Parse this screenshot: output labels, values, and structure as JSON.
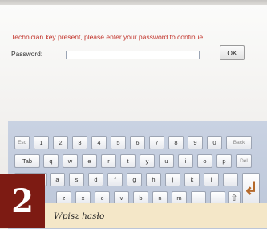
{
  "dialog": {
    "message": "Technician key present, please enter your password to continue",
    "password_label": "Password:",
    "password_value": "",
    "ok_label": "OK"
  },
  "keyboard": {
    "row1": [
      "Esc",
      "1",
      "2",
      "3",
      "4",
      "5",
      "6",
      "7",
      "8",
      "9",
      "0",
      "Back"
    ],
    "row2": [
      "Tab",
      "q",
      "w",
      "e",
      "r",
      "t",
      "y",
      "u",
      "i",
      "o",
      "p",
      "Del"
    ],
    "row3": [
      "",
      "a",
      "s",
      "d",
      "f",
      "g",
      "h",
      "j",
      "k",
      "l",
      ""
    ],
    "row4": [
      "z",
      "x",
      "c",
      "v",
      "b",
      "n",
      "m",
      "",
      ""
    ],
    "shift_icon": "shift-arrow-icon",
    "enter_icon": "enter-arrow-icon"
  },
  "caption": {
    "step_number": "2",
    "text": "Wpisz hasło"
  },
  "colors": {
    "message": "#c2332b",
    "badge": "#7d1b13",
    "caption_bg": "#f4e7c8",
    "enter_arrow": "#b5692a"
  }
}
